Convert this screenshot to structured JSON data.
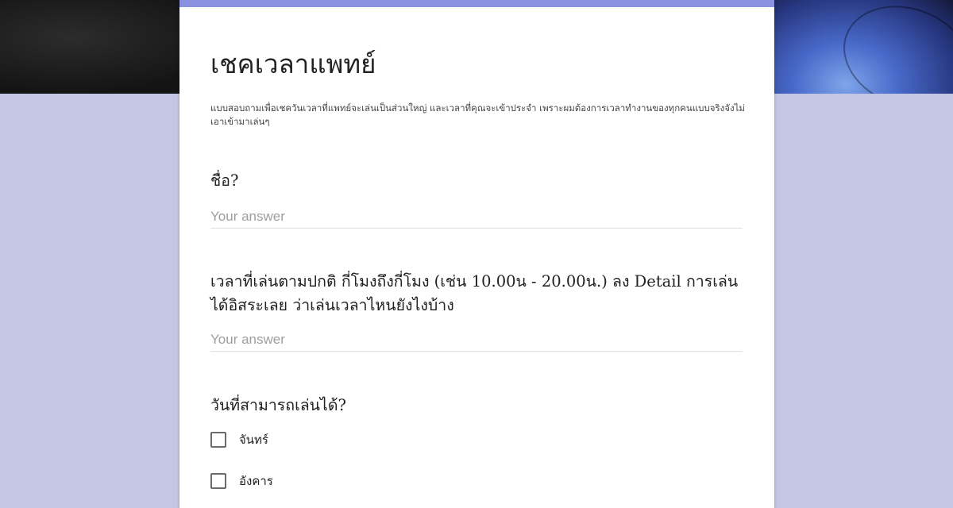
{
  "form": {
    "title": "เชคเวลาแพทย์",
    "description": "แบบสอบถามเพื่อเชควันเวลาที่แพทย์จะเล่นเป็นส่วนใหญ่ และเวลาที่คุณจะเข้าประจำ เพราะผมต้องการเวลาทำงานของทุกคนแบบจริงจังไม่เอาเข้ามาเล่นๆ",
    "accent_color": "#8b91df",
    "background_color": "#c4c7e3"
  },
  "questions": [
    {
      "label": "ชื่อ?",
      "placeholder": "Your answer"
    },
    {
      "label": "เวลาที่เล่นตามปกติ กี่โมงถึงกี่โมง (เช่น 10.00น - 20.00น.) ลง Detail การเล่นได้อิสระเลย ว่าเล่นเวลาไหนยังไงบ้าง",
      "placeholder": "Your answer"
    },
    {
      "label": "วันที่สามารถเล่นได้?",
      "options": [
        "จันทร์",
        "อังคาร"
      ]
    }
  ]
}
